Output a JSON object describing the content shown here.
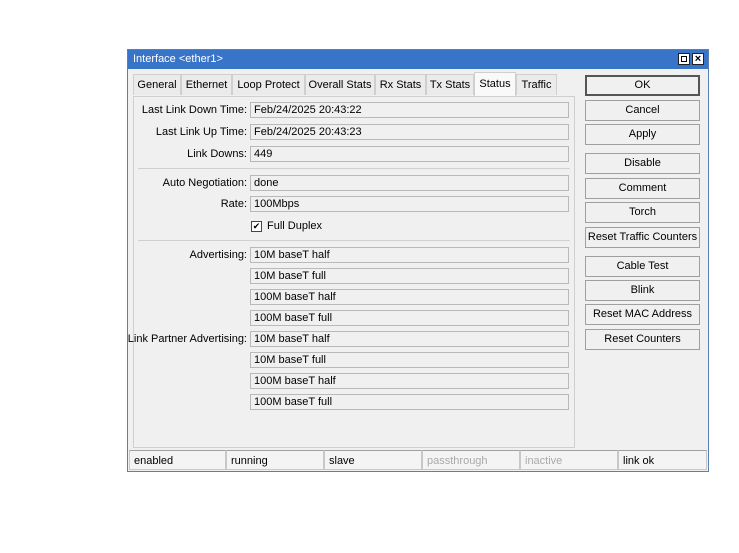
{
  "window": {
    "title": "Interface <ether1>"
  },
  "tabs": [
    {
      "label": "General"
    },
    {
      "label": "Ethernet"
    },
    {
      "label": "Loop Protect"
    },
    {
      "label": "Overall Stats"
    },
    {
      "label": "Rx Stats"
    },
    {
      "label": "Tx Stats"
    },
    {
      "label": "Status",
      "active": true
    },
    {
      "label": "Traffic"
    }
  ],
  "status": {
    "last_link_down_label": "Last Link Down Time:",
    "last_link_down_value": "Feb/24/2025 20:43:22",
    "last_link_up_label": "Last Link Up Time:",
    "last_link_up_value": "Feb/24/2025 20:43:23",
    "link_downs_label": "Link Downs:",
    "link_downs_value": "449",
    "auto_negotiation_label": "Auto Negotiation:",
    "auto_negotiation_value": "done",
    "rate_label": "Rate:",
    "rate_value": "100Mbps",
    "full_duplex_label": "Full Duplex",
    "full_duplex_checked": true,
    "advertising_label": "Advertising:",
    "advertising": [
      "10M baseT half",
      "10M baseT full",
      "100M baseT half",
      "100M baseT full"
    ],
    "partner_label": "Link Partner Advertising:",
    "partner_advertising": [
      "10M baseT half",
      "10M baseT full",
      "100M baseT half",
      "100M baseT full"
    ]
  },
  "buttons": {
    "ok": "OK",
    "cancel": "Cancel",
    "apply": "Apply",
    "disable": "Disable",
    "comment": "Comment",
    "torch": "Torch",
    "reset_traffic": "Reset Traffic Counters",
    "cable_test": "Cable Test",
    "blink": "Blink",
    "reset_mac": "Reset MAC Address",
    "reset_counters": "Reset Counters"
  },
  "statusbar": [
    {
      "text": "enabled",
      "dim": false
    },
    {
      "text": "running",
      "dim": false
    },
    {
      "text": "slave",
      "dim": false
    },
    {
      "text": "passthrough",
      "dim": true
    },
    {
      "text": "inactive",
      "dim": true
    },
    {
      "text": "link ok",
      "dim": false
    }
  ],
  "colors": {
    "titlebar": "#3874c8",
    "window_bg": "#f0f0f0"
  }
}
